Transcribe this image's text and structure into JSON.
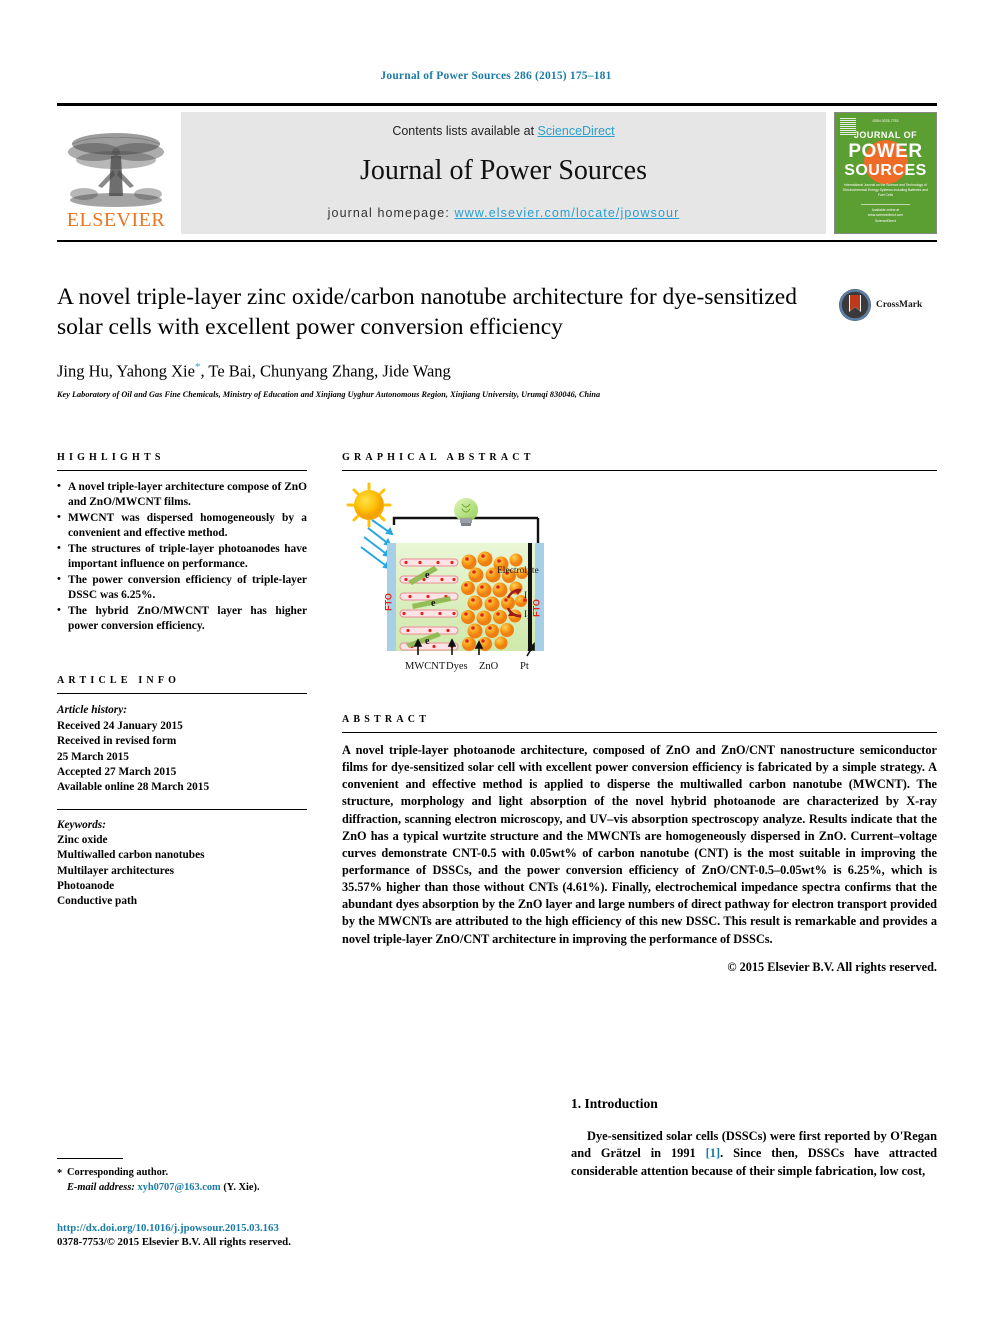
{
  "running_head": "Journal of Power Sources 286 (2015) 175–181",
  "masthead": {
    "publisher_logo_text": "ELSEVIER",
    "contents_prefix": "Contents lists available at",
    "contents_link": "ScienceDirect",
    "journal_title": "Journal of Power Sources",
    "homepage_prefix": "journal homepage:",
    "homepage_url": "www.elsevier.com/locate/jpowsour",
    "cover": {
      "issn_top": "ISSN 0378-7753",
      "line1": "JOURNAL OF",
      "line2": "POWER",
      "line3": "SOURCES",
      "subtitle": "International Journal on the Science and Technology of Electrochemical Energy Systems including Batteries and Fuel Cells",
      "footer": "Available online at www.sciencedirect.com  ScienceDirect"
    }
  },
  "article": {
    "title": "A novel triple-layer zinc oxide/carbon nanotube architecture for dye-sensitized solar cells with excellent power conversion efficiency",
    "authors": "Jing Hu, Yahong Xie",
    "authors_rest": ", Te Bai, Chunyang Zhang, Jide Wang",
    "corresponding_marker": "*",
    "affiliation": "Key Laboratory of Oil and Gas Fine Chemicals, Ministry of Education and Xinjiang Uyghur Autonomous Region, Xinjiang University, Urumqi 830046, China",
    "crossmark_label": "CrossMark"
  },
  "highlights": {
    "label": "HIGHLIGHTS",
    "items": [
      "A novel triple-layer architecture compose of ZnO and ZnO/MWCNT films.",
      "MWCNT was dispersed homogeneously by a convenient and effective method.",
      "The structures of triple-layer photoanodes have important influence on performance.",
      "The power conversion efficiency of triple-layer DSSC was 6.25%.",
      "The hybrid ZnO/MWCNT layer has higher power conversion efficiency."
    ]
  },
  "article_info": {
    "label": "ARTICLE INFO",
    "history_heading": "Article history:",
    "history": [
      "Received 24 January 2015",
      "Received in revised form",
      "25 March 2015",
      "Accepted 27 March 2015",
      "Available online 28 March 2015"
    ],
    "keywords_heading": "Keywords:",
    "keywords": [
      "Zinc oxide",
      "Multiwalled carbon nanotubes",
      "Multilayer architectures",
      "Photoanode",
      "Conductive path"
    ]
  },
  "graphical_abstract": {
    "label": "GRAPHICAL ABSTRACT",
    "figure_labels": {
      "electrode_left": "FTO",
      "electrode_right": "FTO",
      "electrolyte": "Electrolyte",
      "redox_top": "I⁻",
      "redox_bottom": "I₃⁻",
      "electron": "e",
      "bottom_mwcnt": "MWCNT",
      "bottom_dyes": "Dyes",
      "bottom_zno": "ZnO",
      "bottom_pt": "Pt"
    }
  },
  "abstract": {
    "label": "ABSTRACT",
    "body": "A novel triple-layer photoanode architecture, composed of ZnO and ZnO/CNT nanostructure semiconductor films for dye-sensitized solar cell with excellent power conversion efficiency is fabricated by a simple strategy. A convenient and effective method is applied to disperse the multiwalled carbon nanotube (MWCNT). The structure, morphology and light absorption of the novel hybrid photoanode are characterized by X-ray diffraction, scanning electron microscopy, and UV–vis absorption spectroscopy analyze. Results indicate that the ZnO has a typical wurtzite structure and the MWCNTs are homogeneously dispersed in ZnO. Current–voltage curves demonstrate CNT-0.5 with 0.05wt% of carbon nanotube (CNT) is the most suitable in improving the performance of DSSCs, and the power conversion efficiency of ZnO/CNT-0.5–0.05wt% is 6.25%, which is 35.57% higher than those without CNTs (4.61%). Finally, electrochemical impedance spectra confirms that the abundant dyes absorption by the ZnO layer and large numbers of direct pathway for electron transport provided by the MWCNTs are attributed to the high efficiency of this new DSSC. This result is remarkable and provides a novel triple-layer ZnO/CNT architecture in improving the performance of DSSCs.",
    "copyright": "© 2015 Elsevier B.V. All rights reserved."
  },
  "introduction": {
    "heading": "1. Introduction",
    "paragraph_part1": "Dye-sensitized solar cells (DSSCs) were first reported by O'Regan and Grätzel in 1991 ",
    "citation": "[1]",
    "paragraph_part2": ". Since then, DSSCs have attracted considerable attention because of their simple fabrication, low cost,"
  },
  "footnote": {
    "corresponding_author": "Corresponding author.",
    "email_label": "E-mail address:",
    "email": "xyh0707@163.com",
    "email_owner": "(Y. Xie).",
    "doi": "http://dx.doi.org/10.1016/j.jpowsour.2015.03.163",
    "issn_line": "0378-7753/© 2015 Elsevier B.V. All rights reserved."
  },
  "colors": {
    "link_blue": "#1c7ca8",
    "sciencedirect_blue": "#2a9fd0",
    "elsevier_orange": "#e87722",
    "cover_green": "#5b9e31"
  }
}
